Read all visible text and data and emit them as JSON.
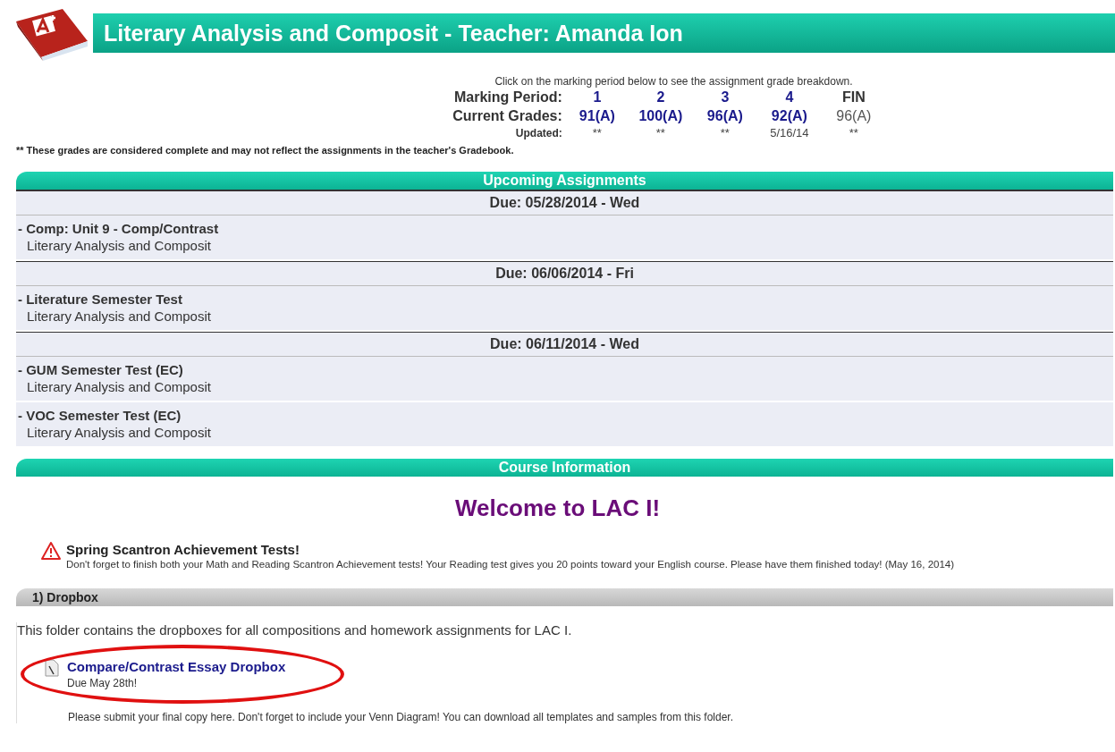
{
  "header": {
    "title": "Literary Analysis and Composit - Teacher: Amanda Ion"
  },
  "grades": {
    "hint": "Click on the marking period below to see the assignment grade breakdown.",
    "period_label": "Marking Period:",
    "grade_label": "Current Grades:",
    "updated_label": "Updated:",
    "periods": [
      {
        "period": "1",
        "grade": "91(A)",
        "updated": "**",
        "link": true
      },
      {
        "period": "2",
        "grade": "100(A)",
        "updated": "**",
        "link": true
      },
      {
        "period": "3",
        "grade": "96(A)",
        "updated": "**",
        "link": true
      },
      {
        "period": "4",
        "grade": "92(A)",
        "updated": "5/16/14",
        "link": true
      },
      {
        "period": "FIN",
        "grade": "96(A)",
        "updated": "**",
        "link": false
      }
    ],
    "note": "** These grades are considered complete and may not reflect the assignments in the teacher's Gradebook."
  },
  "upcoming": {
    "title": "Upcoming Assignments",
    "groups": [
      {
        "due": "Due: 05/28/2014 - Wed",
        "items": [
          {
            "name": "- Comp: Unit 9 - Comp/Contrast",
            "course": "Literary Analysis and Composit"
          }
        ]
      },
      {
        "due": "Due: 06/06/2014 - Fri",
        "items": [
          {
            "name": "- Literature Semester Test",
            "course": "Literary Analysis and Composit"
          }
        ]
      },
      {
        "due": "Due: 06/11/2014 - Wed",
        "items": [
          {
            "name": "- GUM Semester Test (EC)",
            "course": "Literary Analysis and Composit"
          },
          {
            "name": "- VOC Semester Test (EC)",
            "course": "Literary Analysis and Composit"
          }
        ]
      }
    ]
  },
  "course_info": {
    "title": "Course Information",
    "welcome": "Welcome to LAC I!",
    "alert": {
      "title": "Spring Scantron Achievement Tests!",
      "text": "Don't forget to finish both your Math and Reading Scantron Achievement tests! Your Reading test gives you 20 points toward your English course. Please have them finished today! (May 16, 2014)"
    },
    "folder": {
      "title": "1) Dropbox",
      "description": "This folder contains the dropboxes for all compositions and homework assignments for LAC I.",
      "link": "Compare/Contrast Essay Dropbox",
      "due": "Due May 28th!",
      "instructions": "Please submit your final copy here. Don't forget to include your Venn Diagram! You can download all templates and samples from this folder."
    }
  }
}
